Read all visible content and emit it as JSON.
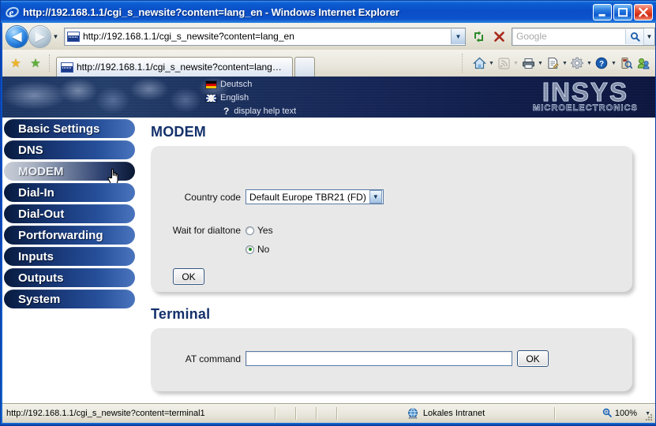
{
  "window": {
    "title": "http://192.168.1.1/cgi_s_newsite?content=lang_en - Windows Internet Explorer",
    "app_icon": "internet-explorer-icon",
    "minimize_label": "_",
    "maximize_label": "❑",
    "close_label": "✕"
  },
  "navbar": {
    "back_label": "◀",
    "forward_label": "▶",
    "history_caret": "▼",
    "address_value": "http://192.168.1.1/cgi_s_newsite?content=lang_en",
    "address_dropdown_caret": "▼",
    "refresh_label": "↻",
    "stop_label": "✕",
    "search_placeholder": "Google",
    "search_go_label": "⌕",
    "search_caret": "▼"
  },
  "tabbar": {
    "favorites_label": "★",
    "add_favorite_label": "★",
    "tab_title": "http://192.168.1.1/cgi_s_newsite?content=lang_en",
    "new_tab_label": "",
    "commands": [
      {
        "name": "home-icon",
        "glyph": "⌂",
        "color": "#2f6aa8",
        "caret": true,
        "dim": false
      },
      {
        "name": "rss-feed-icon",
        "glyph": "◔",
        "color": "#b9b6ad",
        "caret": true,
        "dim": true
      },
      {
        "name": "print-icon",
        "glyph": "⎙",
        "color": "#3c4c5c",
        "caret": true,
        "dim": false
      },
      {
        "name": "page-icon",
        "glyph": "☰",
        "color": "#4a5a6a",
        "caret": true,
        "dim": false
      },
      {
        "name": "tools-gear-icon",
        "glyph": "⚙",
        "color": "#7d8590",
        "caret": true,
        "dim": false
      },
      {
        "name": "help-icon",
        "glyph": "?",
        "color": "#1a5fb4",
        "caret": true,
        "dim": false
      },
      {
        "name": "research-icon",
        "glyph": "⌘",
        "color": "#6a6a5a",
        "caret": false,
        "dim": false
      },
      {
        "name": "messenger-icon",
        "glyph": "☺",
        "color": "#3c8a3c",
        "caret": false,
        "dim": false
      }
    ]
  },
  "banner": {
    "languages": [
      {
        "name": "german",
        "label": "Deutsch",
        "flag": "de"
      },
      {
        "name": "english",
        "label": "English",
        "flag": "uk"
      }
    ],
    "help_icon": "question-mark-icon",
    "help_label": "display help text",
    "logo_main": "INSYS",
    "logo_sub": "MICROELECTRONICS"
  },
  "sidebar": {
    "items": [
      {
        "label": "Basic Settings",
        "active": false
      },
      {
        "label": "DNS",
        "active": false
      },
      {
        "label": "MODEM",
        "active": true
      },
      {
        "label": "Dial-In",
        "active": false
      },
      {
        "label": "Dial-Out",
        "active": false
      },
      {
        "label": "Portforwarding",
        "active": false
      },
      {
        "label": "Inputs",
        "active": false
      },
      {
        "label": "Outputs",
        "active": false
      },
      {
        "label": "System",
        "active": false
      }
    ]
  },
  "main": {
    "modem": {
      "title": "MODEM",
      "country_code_label": "Country code",
      "country_code_value": "Default Europe TBR21 (FD)",
      "country_code_caret": "▼",
      "wait_dialtone_label": "Wait for dialtone",
      "wait_dialtone_yes": "Yes",
      "wait_dialtone_no": "No",
      "wait_dialtone_selected": "No",
      "ok_label": "OK"
    },
    "terminal": {
      "title": "Terminal",
      "at_command_label": "AT command",
      "at_command_value": "",
      "ok_label": "OK"
    }
  },
  "statusbar": {
    "url": "http://192.168.1.1/cgi_s_newsite?content=terminal1",
    "zone_icon": "globe-icon",
    "zone_text": "Lokales Intranet",
    "zoom_icon": "magnifier-icon",
    "zoom_level": "100%",
    "zoom_caret": "▼"
  },
  "colors": {
    "title_blue": "#0a4ec4",
    "nav_navy": "#102a5c",
    "heading_navy": "#14316b",
    "panel_gray": "#e8e8e8",
    "radio_green": "#1f8a1f"
  }
}
